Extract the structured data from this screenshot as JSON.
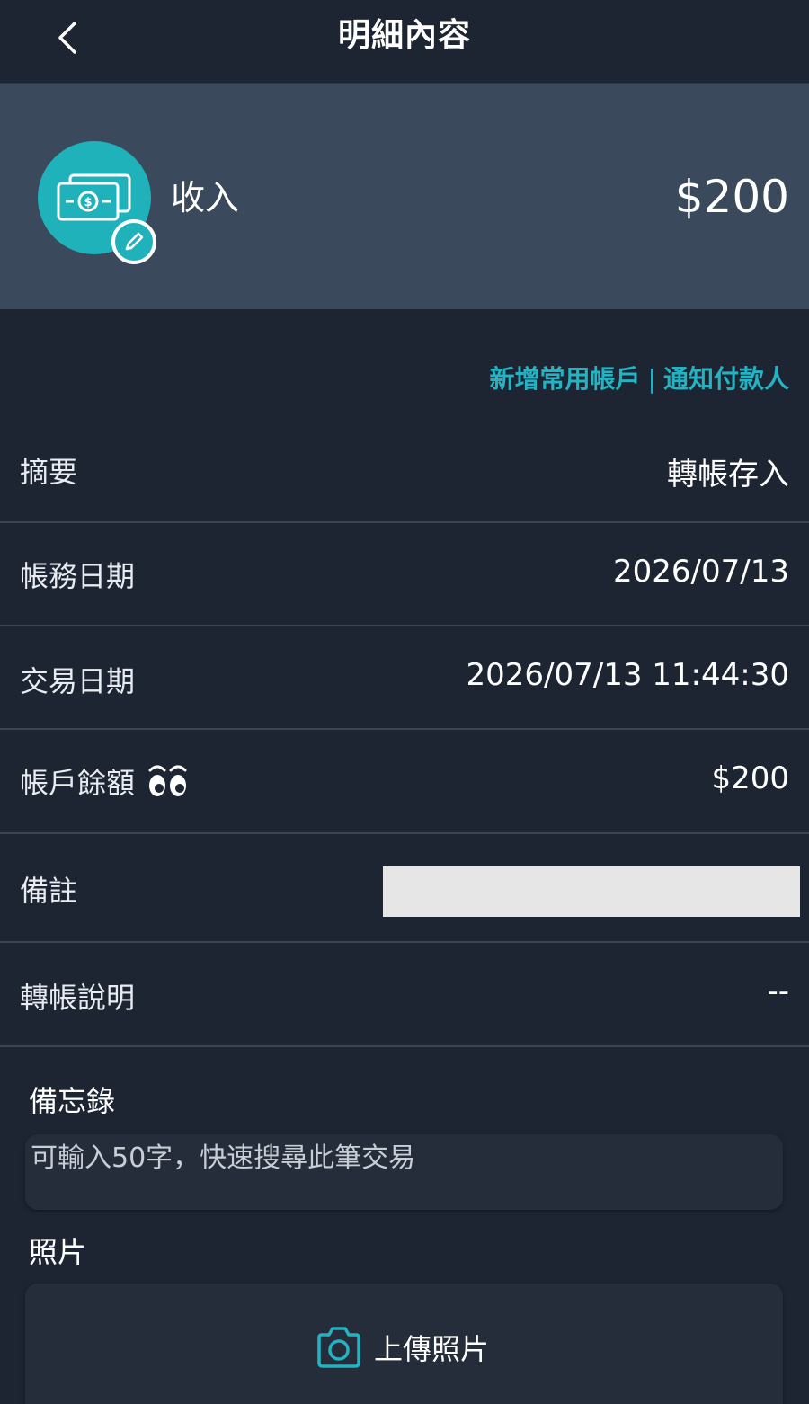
{
  "header": {
    "title": "明細內容"
  },
  "summary": {
    "category": "收入",
    "amount": "$200"
  },
  "quick_links": {
    "add_account": "新增常用帳戶",
    "separator": "|",
    "notify_payer": "通知付款人"
  },
  "rows": [
    {
      "label": "摘要",
      "value": "轉帳存入"
    },
    {
      "label": "帳務日期",
      "value": "2026/07/13"
    },
    {
      "label": "交易日期",
      "value": "2026/07/13 11:44:30"
    },
    {
      "label": "帳戶餘額",
      "value": "$200"
    },
    {
      "label": "備註",
      "value": ""
    },
    {
      "label": "轉帳說明",
      "value": "--"
    }
  ],
  "memo": {
    "title": "備忘錄",
    "placeholder": "可輸入50字，快速搜尋此筆交易",
    "value": ""
  },
  "photo": {
    "title": "照片",
    "upload_label": "上傳照片"
  },
  "icons": {
    "back": "chevron-left-icon",
    "category": "cash-icon",
    "edit": "pencil-icon",
    "balance_toggle": "eyes-icon",
    "upload": "camera-icon"
  },
  "colors": {
    "accent": "#1fb2bb",
    "link": "#23b3c2",
    "background": "#1e2532",
    "card": "#3a4a5c"
  }
}
